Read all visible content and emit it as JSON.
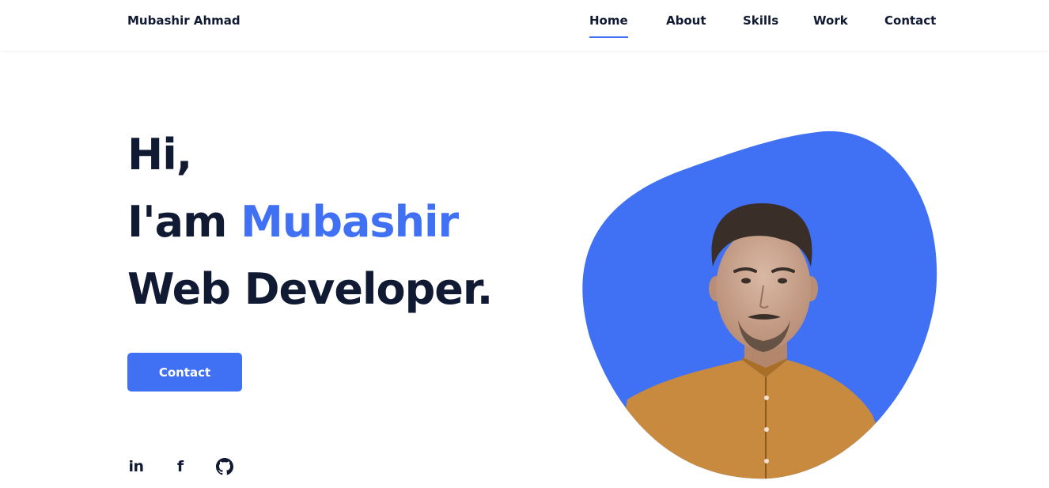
{
  "header": {
    "logo": "Mubashir Ahmad",
    "nav": {
      "home": "Home",
      "about": "About",
      "skills": "Skills",
      "work": "Work",
      "contact": "Contact"
    }
  },
  "hero": {
    "greeting": "Hi,",
    "intro_prefix": "I'am",
    "name": "Mubashir",
    "role": "Web Developer.",
    "contact_button": "Contact"
  },
  "social": {
    "linkedin_label": "in",
    "facebook_label": "f",
    "icons": [
      "linkedin-icon",
      "facebook-icon",
      "github-icon"
    ]
  },
  "colors": {
    "accent": "#4070f4",
    "text": "#111a33",
    "shirt": "#c88a3e"
  }
}
